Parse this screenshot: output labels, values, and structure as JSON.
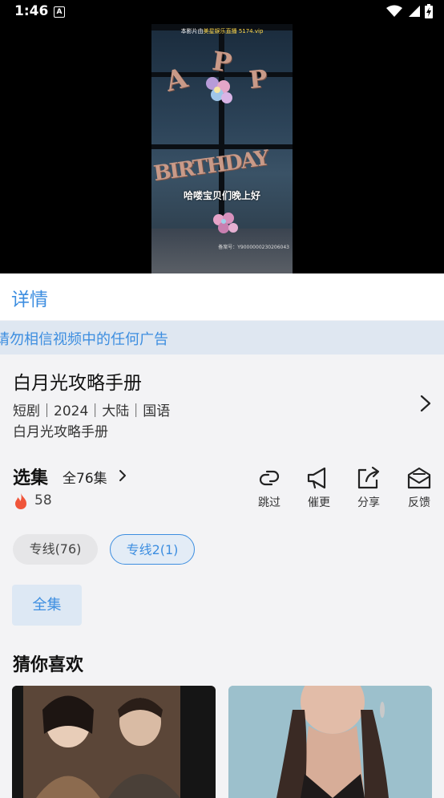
{
  "status_bar": {
    "time": "1:46",
    "notification_icon": "A"
  },
  "video": {
    "watermark_prefix": "本影片由",
    "watermark_highlight": "美星娱乐直播 5174.vip",
    "subtitle": "哈喽宝贝们晚上好",
    "record_id": "备案号：Y9000000230206043",
    "balloon_letters": [
      "A",
      "P",
      "P"
    ],
    "banner_text": "BIRTHDAY"
  },
  "details": {
    "header": "详情",
    "notice": "请勿相信视频中的任何广告",
    "show_title": "白月光攻略手册",
    "meta": "短剧｜2024｜大陆｜国语",
    "subtitle": "白月光攻略手册"
  },
  "episodes": {
    "label": "选集",
    "count": "全76集",
    "heat": "58"
  },
  "actions": [
    {
      "label": "跳过",
      "icon": "skip-link-icon"
    },
    {
      "label": "催更",
      "icon": "megaphone-icon"
    },
    {
      "label": "分享",
      "icon": "share-icon"
    },
    {
      "label": "反馈",
      "icon": "feedback-mail-icon"
    }
  ],
  "sources": [
    {
      "label": "专线(76)",
      "selected": false
    },
    {
      "label": "专线2(1)",
      "selected": true
    }
  ],
  "episode_button": "全集",
  "recommend": {
    "title": "猜你喜欢"
  },
  "colors": {
    "accent": "#3d8ee0",
    "background": "#f3f3f5",
    "notice_bg": "#dfe7f1",
    "fire": "#f0553a"
  }
}
